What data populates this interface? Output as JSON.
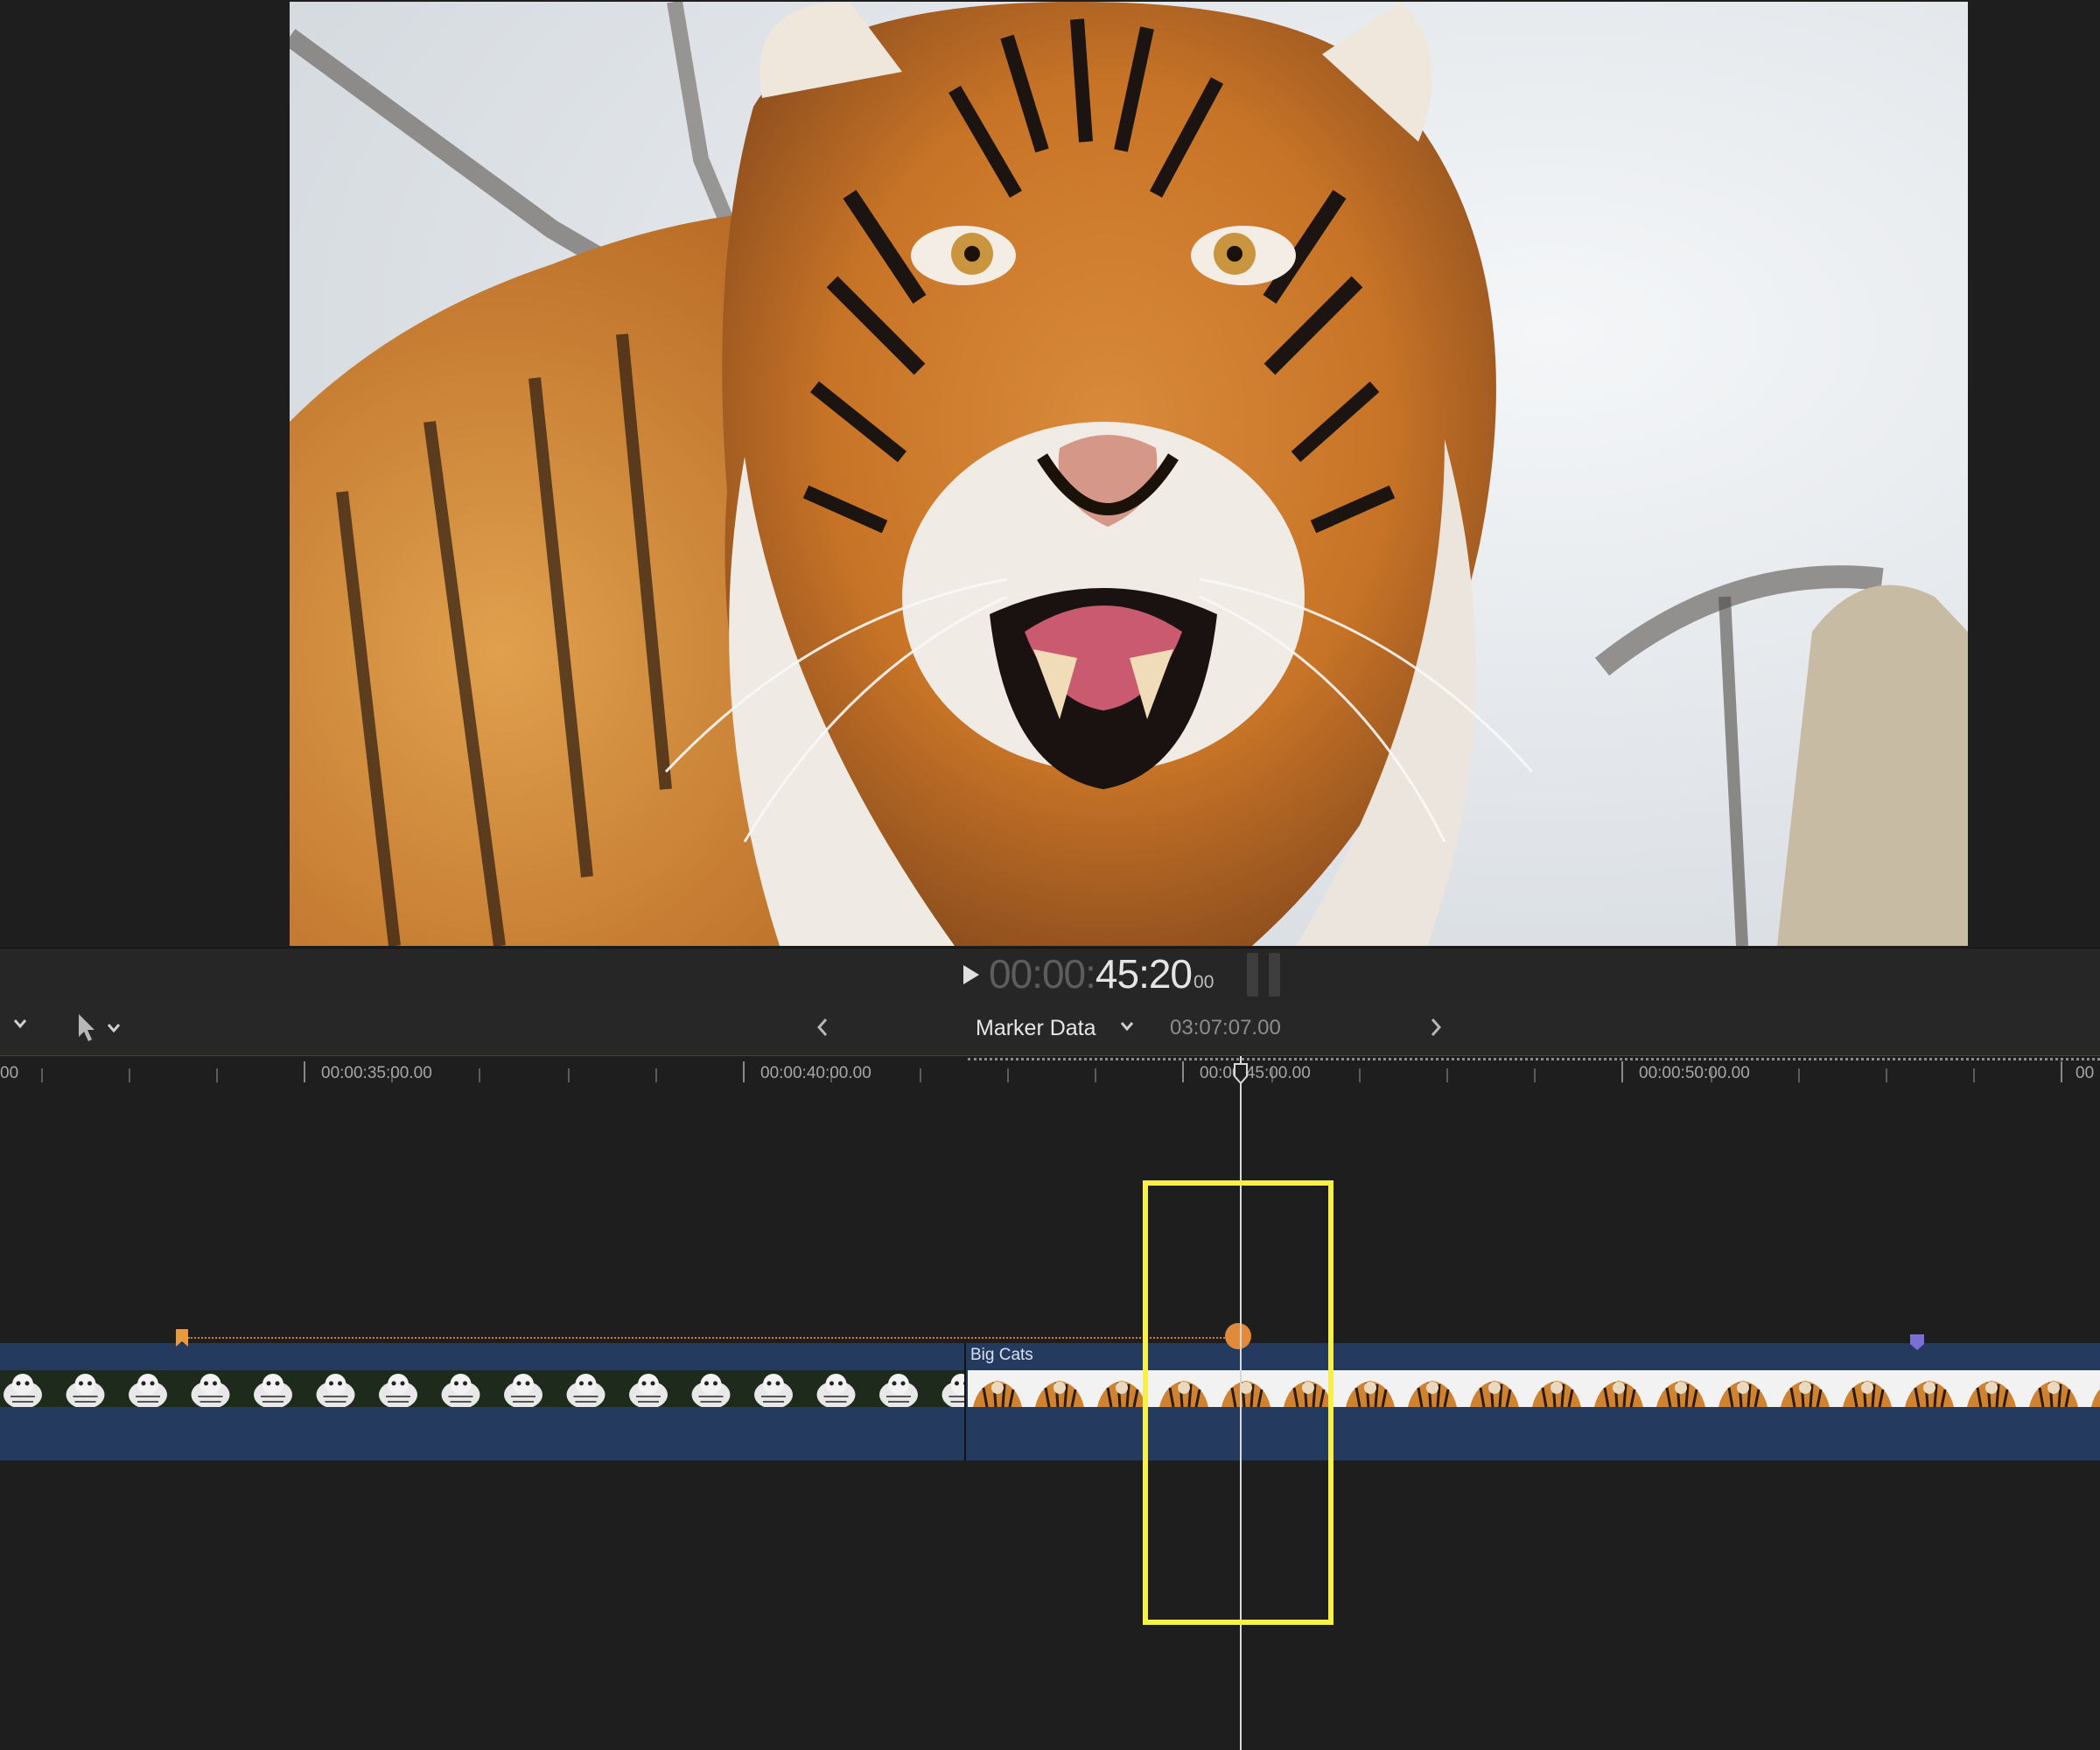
{
  "viewer": {
    "frame_description_icon": "tiger-video-frame"
  },
  "transport": {
    "play_icon": "play-icon",
    "timecode_dim": "00:00:",
    "timecode_main": "45:20",
    "timecode_frames": "00"
  },
  "timeline_header": {
    "tool_icon": "arrow-select-icon",
    "prev_icon": "chevron-left-icon",
    "next_icon": "chevron-right-icon",
    "project_title": "Marker Data",
    "project_duration": "03:07:07.00"
  },
  "ruler": {
    "labels": [
      "00",
      "00:00:35:00.00",
      "00:00:40:00.00",
      "00:00:45:00.00",
      "00:00:50:00.00",
      "00"
    ]
  },
  "clips": {
    "tiger_clip_title": "Big Cats"
  },
  "colors": {
    "accent_playhead": "#d9d9d9",
    "marker_orange": "#e08a3a",
    "marker_purple": "#7b6fd6",
    "highlight_yellow": "#f7f04a",
    "storyline_blue": "#243a5e"
  }
}
